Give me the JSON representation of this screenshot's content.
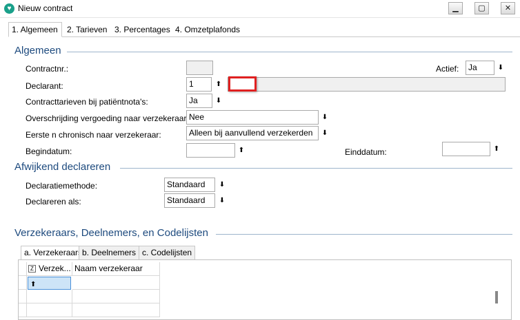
{
  "window": {
    "title": "Nieuw contract",
    "minimize_icon": "minimize-icon",
    "maximize_icon": "maximize-icon",
    "close_icon": "close-icon"
  },
  "tabs": [
    {
      "label": "1. Algemeen",
      "active": true
    },
    {
      "label": "2. Tarieven",
      "active": false
    },
    {
      "label": "3. Percentages",
      "active": false
    },
    {
      "label": "4. Omzetplafonds",
      "active": false
    }
  ],
  "algemeen": {
    "heading": "Algemeen",
    "contractnr_label": "Contractnr.:",
    "contractnr_value": "",
    "actief_label": "Actief:",
    "actief_value": "Ja",
    "declarant_label": "Declarant:",
    "declarant_value": "1",
    "declarant_name": "",
    "contracttarieven_label": "Contracttarieven bij patiëntnota's:",
    "contracttarieven_value": "Ja",
    "overschrijding_label": "Overschrijding vergoeding naar verzekeraar:",
    "overschrijding_value": "Nee",
    "eerste_label": "Eerste n chronisch naar verzekeraar:",
    "eerste_value": "Alleen bij aanvullend verzekerden",
    "begindatum_label": "Begindatum:",
    "begindatum_value": "",
    "einddatum_label": "Einddatum:",
    "einddatum_value": ""
  },
  "afwijkend": {
    "heading": "Afwijkend declareren",
    "methode_label": "Declaratiemethode:",
    "methode_value": "Standaard",
    "als_label": "Declareren als:",
    "als_value": "Standaard"
  },
  "verzekeraars": {
    "heading": "Verzekeraars, Deelnemers, en Codelijsten",
    "subtabs": [
      {
        "label": "a. Verzekeraars",
        "active": true
      },
      {
        "label": "b. Deelnemers",
        "active": false
      },
      {
        "label": "c. Codelijsten",
        "active": false
      }
    ],
    "columns": [
      "Verzek...",
      "Naam verzekeraar"
    ]
  },
  "colors": {
    "section_heading": "#1d4a7e",
    "highlight_border": "#e02020",
    "app_icon": "#1aa08a"
  }
}
